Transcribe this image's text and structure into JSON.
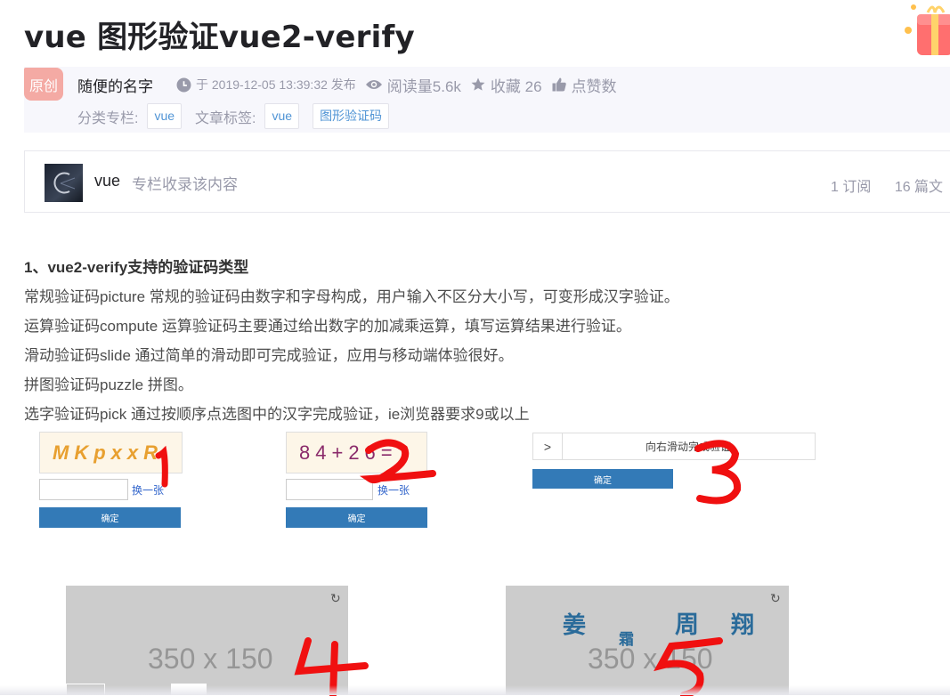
{
  "article": {
    "title": "vue 图形验证vue2-verify",
    "badge": "原创",
    "author": "随便的名字",
    "publish_info": "于 2019-12-05 13:39:32 发布",
    "reads": "阅读量5.6k",
    "favorites": "收藏 26",
    "likes": "点赞数",
    "category_label": "分类专栏:",
    "category_tag": "vue",
    "tags_label": "文章标签:",
    "tags": [
      "vue",
      "图形验证码"
    ]
  },
  "column": {
    "name": "vue",
    "description": "专栏收录该内容",
    "subscribers": "1 订阅",
    "posts": "16 篇文"
  },
  "content": {
    "heading": "1、vue2-verify支持的验证码类型",
    "lines": [
      "常规验证码picture 常规的验证码由数字和字母构成，用户输入不区分大小写，可变形成汉字验证。",
      "运算验证码compute 运算验证码主要通过给出数字的加减乘运算，填写运算结果进行验证。",
      "滑动验证码slide 通过简单的滑动即可完成验证，应用与移动端体验很好。",
      "拼图验证码puzzle 拼图。",
      "选字验证码pick 通过按顺序点选图中的汉字完成验证，ie浏览器要求9或以上"
    ]
  },
  "demo": {
    "picture_code": "MKpxxR",
    "compute_code": "84+26=?",
    "swap_label": "换一张",
    "confirm_label": "确定",
    "slide_text": "向右滑动完成验证",
    "slide_handle": ">",
    "placeholder": "350 x 150",
    "refresh": "↻",
    "pick_chars": [
      "姜",
      "霜",
      "周",
      "翔"
    ],
    "annotations": [
      "1",
      "2",
      "3",
      "4",
      "5"
    ]
  },
  "colors": {
    "badge": "#f4aaa4",
    "link": "#5094d5",
    "confirm": "#337ab7",
    "annotation": "#f01010"
  }
}
